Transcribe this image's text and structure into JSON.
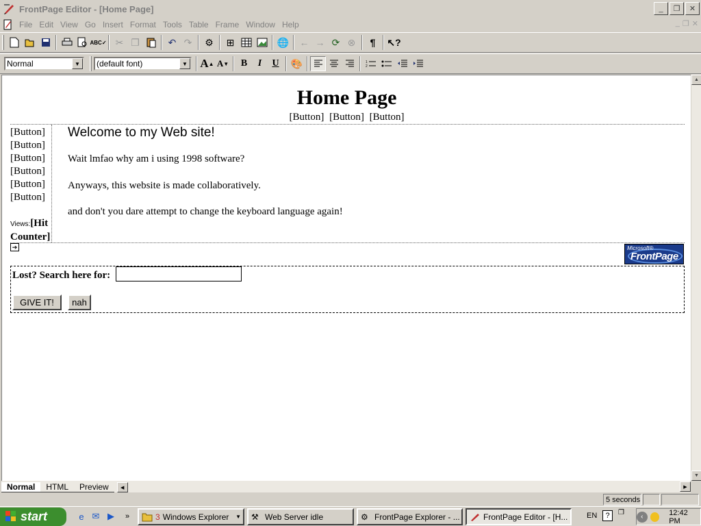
{
  "window": {
    "title": "FrontPage Editor - [Home Page]",
    "controls": [
      "minimize",
      "restore",
      "close"
    ]
  },
  "menu": [
    "File",
    "Edit",
    "View",
    "Go",
    "Insert",
    "Format",
    "Tools",
    "Table",
    "Frame",
    "Window",
    "Help"
  ],
  "toolbar": {
    "style_value": "Normal",
    "font_value": "(default font)",
    "bold_label": "B",
    "italic_label": "I",
    "underline_label": "U",
    "paragraph_mark": "¶"
  },
  "page": {
    "title": "Home Page",
    "top_nav": [
      "[Button]",
      "[Button]",
      "[Button]"
    ],
    "side_nav": [
      "[Button]",
      "[Button]",
      "[Button]",
      "[Button]",
      "[Button]",
      "[Button]"
    ],
    "views_label": "Views:",
    "hit_counter": "[Hit Counter]",
    "welcome": "Welcome to my Web site!",
    "paragraphs": [
      "Wait lmfao why am i using 1998 software?",
      "Anyways, this website is made collaboratively.",
      "and don't you dare attempt to change the keyboard language again!"
    ],
    "logo": {
      "small": "Microsoft®",
      "big": "FrontPage"
    },
    "search": {
      "label": "Lost? Search here for:",
      "value": "",
      "submit": "GIVE IT!",
      "reset": "nah"
    }
  },
  "tabs": [
    "Normal",
    "HTML",
    "Preview"
  ],
  "status": {
    "time": "5 seconds"
  },
  "taskbar": {
    "start": "start",
    "tasks": [
      {
        "label": "Windows Explorer",
        "count": "3"
      },
      {
        "label": "Web Server idle"
      },
      {
        "label": "FrontPage Explorer - ..."
      },
      {
        "label": "FrontPage Editor - [H..."
      }
    ],
    "lang": "EN",
    "clock": "12:42 PM"
  },
  "colors": {
    "start_green": "#3c8e2e",
    "logo_blue": "#1a3a8a"
  }
}
